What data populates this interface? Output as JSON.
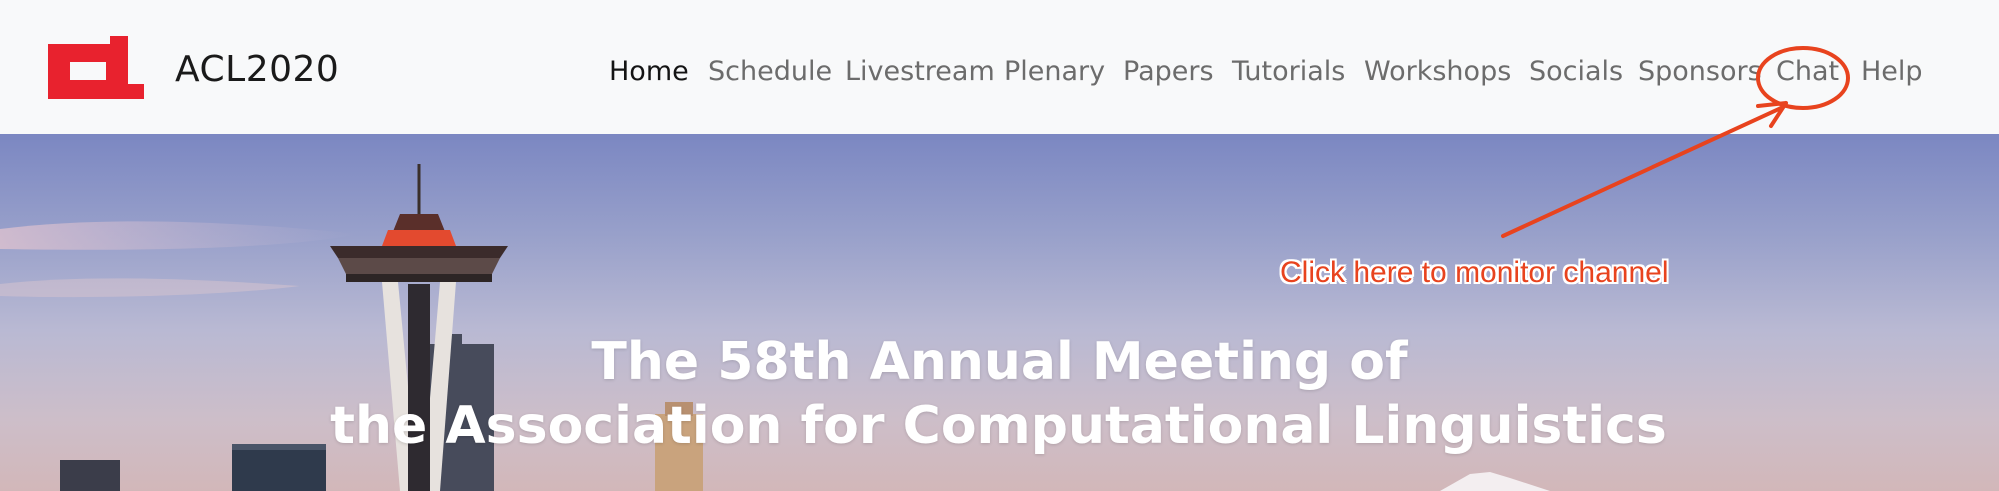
{
  "brand": {
    "name": "ACL2020"
  },
  "nav": {
    "items": [
      {
        "label": "Home",
        "active": true
      },
      {
        "label": "Schedule"
      },
      {
        "label": "Livestream"
      },
      {
        "label": "Plenary"
      },
      {
        "label": "Papers"
      },
      {
        "label": "Tutorials"
      },
      {
        "label": "Workshops"
      },
      {
        "label": "Socials"
      },
      {
        "label": "Sponsors"
      },
      {
        "label": "Chat"
      },
      {
        "label": "Help"
      }
    ]
  },
  "hero": {
    "title_line1": "The 58th Annual Meeting of",
    "title_line2": "the Association for Computational Linguistics"
  },
  "annotation": {
    "text": "Click here to monitor channel",
    "color": "#e8431e"
  },
  "colors": {
    "logo": "#e8222e",
    "nav_active": "#141414",
    "nav_inactive": "#6c6c6c"
  }
}
